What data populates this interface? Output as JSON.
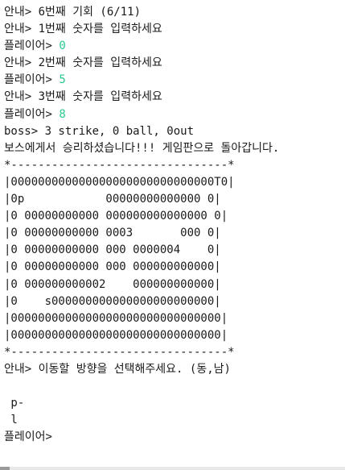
{
  "console": {
    "log": [
      {
        "id": "msg-round",
        "prefix": "안내> ",
        "text": "6번째 기회 (6/11)"
      },
      {
        "id": "msg-ask-1",
        "prefix": "안내> ",
        "text": "1번째 숫자를 입력하세요"
      },
      {
        "id": "input-1",
        "prefix": "플레이어> ",
        "value": "0"
      },
      {
        "id": "msg-ask-2",
        "prefix": "안내> ",
        "text": "2번째 숫자를 입력하세요"
      },
      {
        "id": "input-2",
        "prefix": "플레이어> ",
        "value": "5"
      },
      {
        "id": "msg-ask-3",
        "prefix": "안내> ",
        "text": "3번째 숫자를 입력하세요"
      },
      {
        "id": "input-3",
        "prefix": "플레이어> ",
        "value": "8"
      },
      {
        "id": "boss-result",
        "text": "boss> 3 strike, 0 ball, 0out"
      },
      {
        "id": "victory",
        "text": "보스에게서 승리하셨습니다!!! 게임판으로 돌아갑니다."
      }
    ],
    "board": {
      "top_border": "*--------------------------------*",
      "rows": [
        "|000000000000000000000000000000T0|",
        "|0p            00000000000000 0|",
        "|0 00000000000 000000000000000 0|",
        "|0 00000000000 0003       000 0|",
        "|0 00000000000 000 0000004    0|",
        "|0 00000000000 000 000000000000|",
        "|0 000000000002    000000000000|",
        "|0    s000000000000000000000000|",
        "|0000000000000000000000000000000|",
        "|0000000000000000000000000000000|"
      ],
      "bottom_border": "*--------------------------------*"
    },
    "direction_prompt": {
      "prefix": "안내> ",
      "text": "이동할 방향을 선택해주세요. (동,남)"
    },
    "legend": {
      "line1": " p-",
      "line2": " l"
    },
    "player_prompt": "플레이어>"
  }
}
